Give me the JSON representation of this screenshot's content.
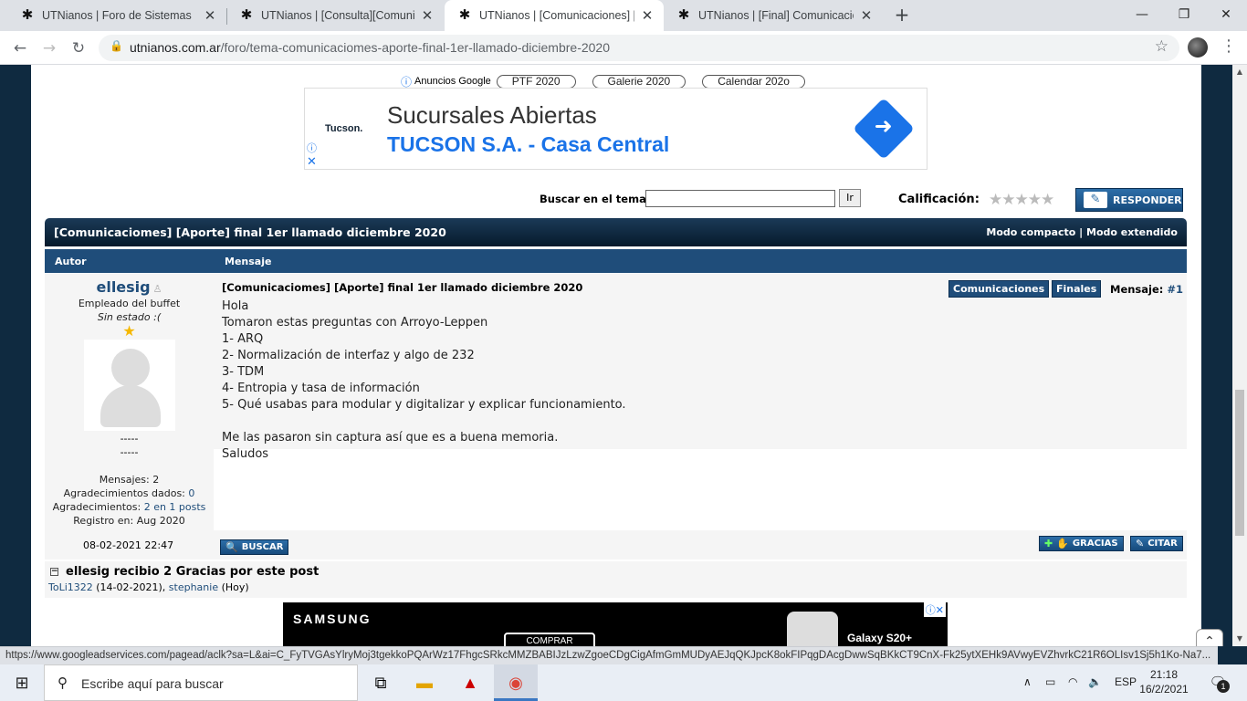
{
  "browser": {
    "tabs": [
      {
        "label": "UTNianos | Foro de Sistemas",
        "active": false
      },
      {
        "label": "UTNianos | [Consulta][Comunicaci",
        "active": false
      },
      {
        "label": "UTNianos | [Comunicaciones] [A",
        "active": true
      },
      {
        "label": "UTNianos | [Final] Comunicacion",
        "active": false
      }
    ],
    "url_host": "utnianos.com.ar",
    "url_path": "/foro/tema-comunicaciomes-aporte-final-1er-llamado-diciembre-2020"
  },
  "ads": {
    "google_label": "Anuncios Google",
    "pills": [
      "PTF 2020",
      "Galerie 2020",
      "Calendar 202o"
    ],
    "banner_brand": "Tucson.",
    "banner_headline": "Sucursales Abiertas",
    "banner_sub": "TUCSON S.A. - Casa Central",
    "bottom_logo": "SAMSUNG",
    "bottom_cta": "COMPRAR",
    "bottom_product": "Galaxy S20+"
  },
  "toolbar": {
    "search_label": "Buscar en el tema",
    "search_value": "",
    "search_button": "Ir",
    "rating_label": "Calificación:",
    "rating_stars": 0,
    "reply_button": "RESPONDER"
  },
  "thread": {
    "title": "[Comunicaciomes] [Aporte] final 1er llamado diciembre 2020",
    "mode_compact": "Modo compacto",
    "mode_sep": "|",
    "mode_extended": "Modo extendido",
    "col_author": "Autor",
    "col_message": "Mensaje"
  },
  "post": {
    "author": {
      "name": "ellesig",
      "role": "Empleado del buffet",
      "status": "Sin estado :(",
      "dash1": "-----",
      "dash2": "-----",
      "posts_label": "Mensajes:",
      "posts": "2",
      "thanks_given_label": "Agradecimientos dados:",
      "thanks_given": "0",
      "thanks_label": "Agradecimientos:",
      "thanks": "2 en 1 posts",
      "registered_label": "Registro en:",
      "registered": "Aug 2020"
    },
    "title": "[Comunicaciomes] [Aporte] final 1er llamado diciembre 2020",
    "tags": [
      "Comunicaciones",
      "Finales"
    ],
    "number_label": "Mensaje:",
    "number": "#1",
    "body_lines": [
      "Hola",
      "Tomaron estas preguntas con Arroyo-Leppen",
      "1- ARQ",
      "2- Normalización de interfaz y algo de 232",
      "3- TDM",
      "4- Entropia y tasa de información",
      "5- Qué usabas para modular y digitalizar y explicar funcionamiento.",
      "",
      "Me las pasaron sin captura así que es a buena memoria.",
      "Saludos"
    ],
    "date": "08-02-2021 22:47",
    "search_button": "BUSCAR",
    "thanks_button": "GRACIAS",
    "quote_button": "CITAR"
  },
  "thanks": {
    "title": "ellesig recibio 2 Gracias por este post",
    "users": [
      {
        "name": "ToLi1322",
        "date": "(14-02-2021)"
      },
      {
        "name": "stephanie",
        "date": "(Hoy)"
      }
    ]
  },
  "status_bar_url": "https://www.googleadservices.com/pagead/aclk?sa=L&ai=C_FyTVGAsYlryMoj3tgekkoPQArWz17FhgcSRkcMMZBABIJzLzwZgoeCDgCigAfmGmMUDyAEJqQKJpcK8okFIPqgDAcgDwwSqBKkCT9CnX-Fk25ytXEHk9AVwyEVZhvrkC21R6OLIsv1Sj5h1Ko-Na7...",
  "taskbar": {
    "search_placeholder": "Escribe aquí para buscar",
    "language": "ESP",
    "time": "21:18",
    "date": "16/2/2021",
    "notifications": "1"
  }
}
